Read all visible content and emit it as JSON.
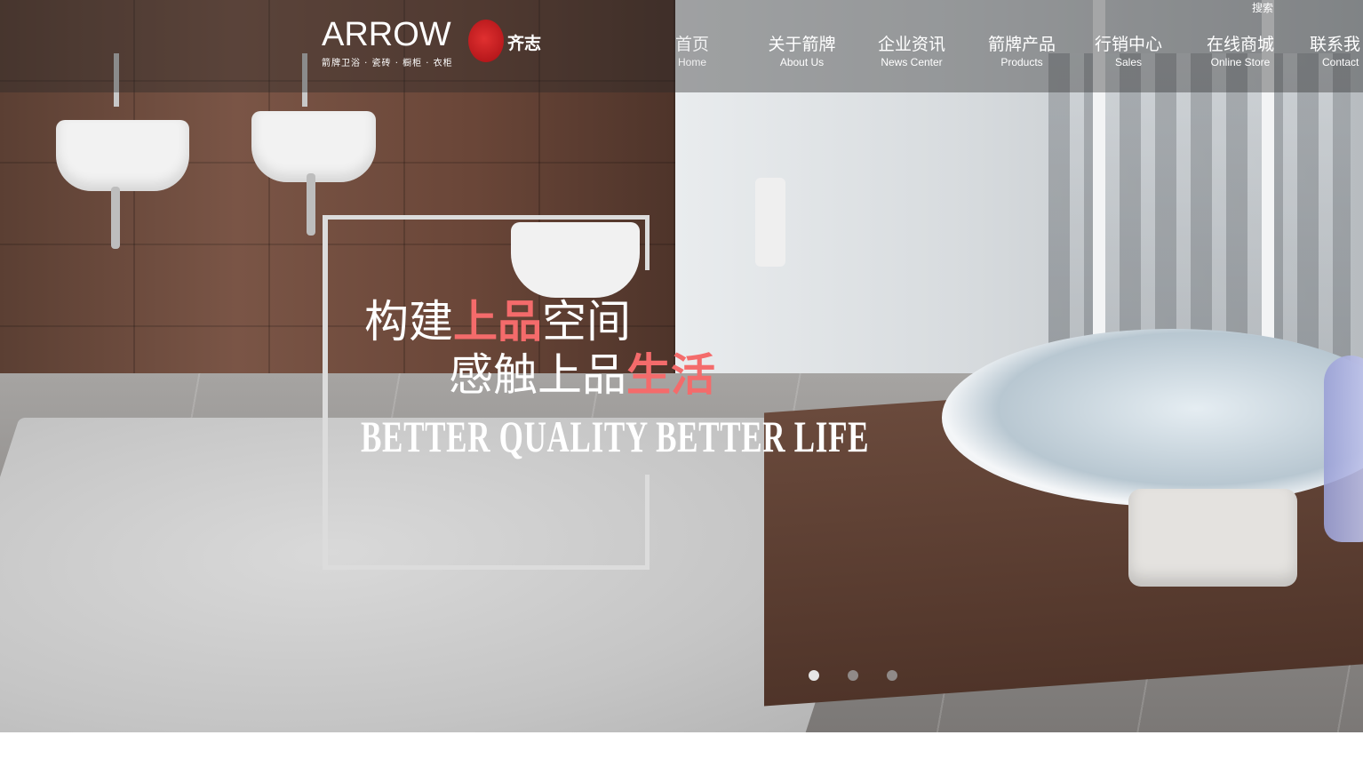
{
  "header": {
    "logo_word": "ARROW",
    "logo_sub": "箭牌卫浴 · 瓷砖 · 橱柜 · 衣柜",
    "brand_name": "齐志",
    "search_label": "搜索"
  },
  "nav": [
    {
      "zh": "首页",
      "en": "Home",
      "active": true
    },
    {
      "zh": "关于箭牌",
      "en": "About Us"
    },
    {
      "zh": "企业资讯",
      "en": "News Center"
    },
    {
      "zh": "箭牌产品",
      "en": "Products"
    },
    {
      "zh": "行销中心",
      "en": "Sales"
    },
    {
      "zh": "在线商城",
      "en": "Online Store"
    },
    {
      "zh": "联系我",
      "en": "Contact"
    }
  ],
  "slide": {
    "line1_a": "构建",
    "line1_hl": "上品",
    "line1_b": "空间",
    "line2_a": "感触上品",
    "line2_hl": "生活",
    "tagline": "BETTER QUALITY BETTER LIFE"
  },
  "carousel": {
    "count": 3,
    "active_index": 0
  },
  "colors": {
    "highlight": "#f46b6b",
    "topbar": "rgba(40,40,40,0.38)"
  }
}
